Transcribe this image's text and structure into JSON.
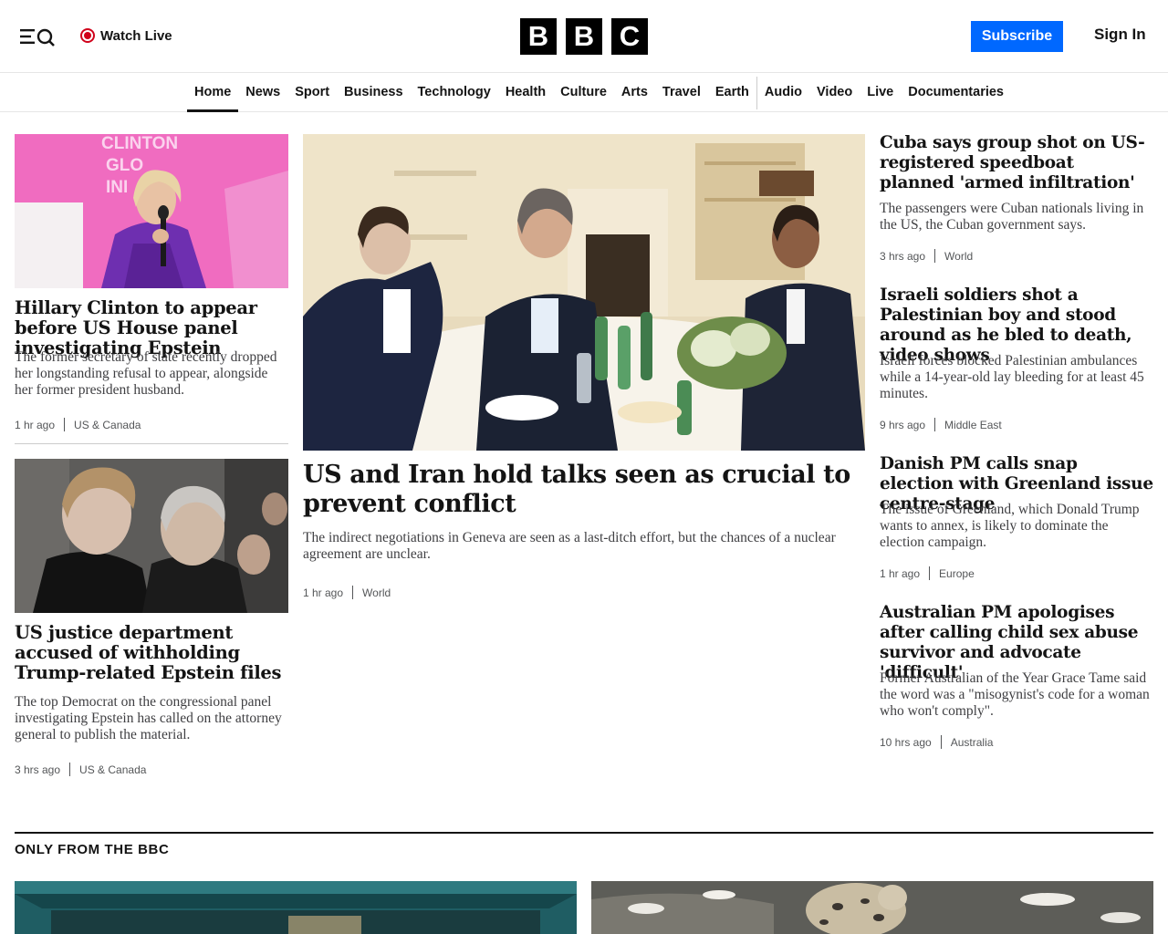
{
  "header": {
    "watch_live": "Watch Live",
    "logo": [
      "B",
      "B",
      "C"
    ],
    "subscribe": "Subscribe",
    "sign_in": "Sign In",
    "accent": "#0068ff",
    "live_color": "#d0021b"
  },
  "nav": {
    "items": [
      "Home",
      "News",
      "Sport",
      "Business",
      "Technology",
      "Health",
      "Culture",
      "Arts",
      "Travel",
      "Earth",
      "Audio",
      "Video",
      "Live",
      "Documentaries"
    ],
    "active": "Home"
  },
  "left": [
    {
      "headline": "Hillary Clinton to appear before US House panel investigating Epstein",
      "summary": "The former secretary of state recently dropped her longstanding refusal to appear, alongside her former president husband.",
      "time": "1 hr ago",
      "category": "US & Canada"
    },
    {
      "headline": "US justice department accused of withholding Trump-related Epstein files",
      "summary": "The top Democrat on the congressional panel investigating Epstein has called on the attorney general to publish the material.",
      "time": "3 hrs ago",
      "category": "US & Canada"
    }
  ],
  "main": {
    "headline": "US and Iran hold talks seen as crucial to prevent conflict",
    "summary": "The indirect negotiations in Geneva are seen as a last-ditch effort, but the chances of a nuclear agreement are unclear.",
    "time": "1 hr ago",
    "category": "World"
  },
  "right": [
    {
      "headline": "Cuba says group shot on US-registered speedboat planned 'armed infiltration'",
      "summary": "The passengers were Cuban nationals living in the US, the Cuban government says.",
      "time": "3 hrs ago",
      "category": "World"
    },
    {
      "headline": "Israeli soldiers shot a Palestinian boy and stood around as he bled to death, video shows",
      "summary": "Israeli forces blocked Palestinian ambulances while a 14-year-old lay bleeding for at least 45 minutes.",
      "time": "9 hrs ago",
      "category": "Middle East"
    },
    {
      "headline": "Danish PM calls snap election with Greenland issue centre-stage",
      "summary": "The issue of Greenland, which Donald Trump wants to annex, is likely to dominate the election campaign.",
      "time": "1 hr ago",
      "category": "Europe"
    },
    {
      "headline": "Australian PM apologises after calling child sex abuse survivor and advocate 'difficult'",
      "summary": "Former Australian of the Year Grace Tame said the word was a \"misogynist's code for a woman who won't comply\".",
      "time": "10 hrs ago",
      "category": "Australia"
    }
  ],
  "section": {
    "title": "ONLY FROM THE BBC"
  }
}
